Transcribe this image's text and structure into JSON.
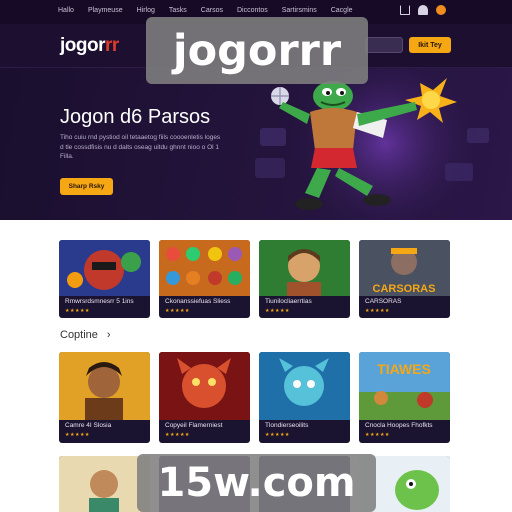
{
  "topnav": {
    "links": [
      "Hallo",
      "Playmeuse",
      "Hirlog",
      "Tasks",
      "Carsos",
      "Diccontos",
      "Sartirsmins",
      "Cacgle"
    ]
  },
  "header": {
    "logo_main": "jogor",
    "logo_accent": "rr",
    "login_label": "",
    "join_label": "Ikit Tey"
  },
  "hero": {
    "title": "Jogon d6 Parsos",
    "description": "Tiho cuiu rnd pystiod oil tetaaetog fiils coooenletis loges d tle cossdfisis nu d dalts oseag uitdu ghnnt nioo o Ol 1 Filla.",
    "cta_label": "Sharp Rsky"
  },
  "watermarks": {
    "top": "jogorrr",
    "bottom": "15w.com"
  },
  "games_row1": [
    {
      "title": "Rmwrsrdsmnesrr 5 1ins",
      "stars": "★★★★★"
    },
    {
      "title": "Ckonanssiefuas Sliess",
      "stars": "★★★★★"
    },
    {
      "title": "Tiunilocliaerrtias",
      "stars": "★★★★★"
    },
    {
      "title": "CARSORAS",
      "stars": "★★★★★"
    }
  ],
  "section": {
    "title": "Coptine",
    "chevron": "›"
  },
  "games_row2": [
    {
      "title": "Camre 4I Slosia",
      "stars": "★★★★★"
    },
    {
      "title": "Copyeil Flamerniest",
      "stars": "★★★★★"
    },
    {
      "title": "Tlondierseoilits",
      "stars": "★★★★★"
    },
    {
      "title": "Cnocla Hoopes Fhofkts",
      "stars": "★★★★★"
    }
  ],
  "colors": {
    "accent": "#f5a814",
    "header_bg": "#1c0f30",
    "card_bg": "#1b1430"
  }
}
